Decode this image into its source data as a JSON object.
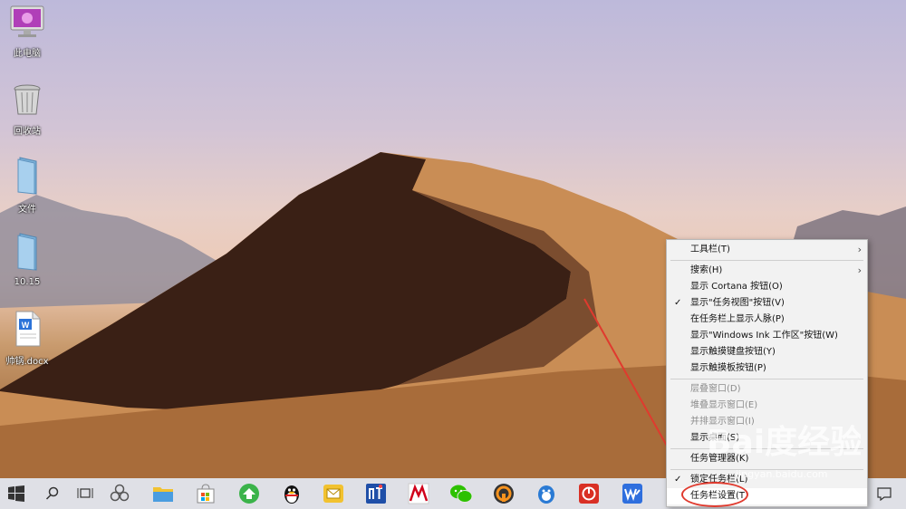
{
  "desktop_icons": [
    {
      "label": "此电脑",
      "icon": "computer-monitor-icon"
    },
    {
      "label": "回收站",
      "icon": "recycle-bin-icon"
    },
    {
      "label": "文件",
      "icon": "folder-icon"
    },
    {
      "label": "10.15",
      "icon": "folder-icon"
    },
    {
      "label": "帅锅.docx",
      "icon": "word-document-icon"
    }
  ],
  "context_menu": {
    "items": [
      {
        "label": "工具栏(T)",
        "has_submenu": true
      },
      {
        "label": "搜索(H)",
        "has_submenu": true
      },
      {
        "label": "显示 Cortana 按钮(O)"
      },
      {
        "label": "显示\"任务视图\"按钮(V)",
        "checked": true
      },
      {
        "label": "在任务栏上显示人脉(P)"
      },
      {
        "label": "显示\"Windows Ink 工作区\"按钮(W)"
      },
      {
        "label": "显示触摸键盘按钮(Y)"
      },
      {
        "label": "显示触摸板按钮(P)"
      },
      {
        "label": "层叠窗口(D)",
        "disabled": true
      },
      {
        "label": "堆叠显示窗口(E)",
        "disabled": true
      },
      {
        "label": "并排显示窗口(I)",
        "disabled": true
      },
      {
        "label": "显示桌面(S)"
      },
      {
        "label": "任务管理器(K)"
      },
      {
        "label": "锁定任务栏(L)",
        "checked": true
      },
      {
        "label": "任务栏设置(T)"
      }
    ]
  },
  "taskbar": {
    "icons": [
      "windows-start-icon",
      "search-icon",
      "task-view-icon",
      "pinwheel-icon",
      "file-explorer-icon",
      "store-icon",
      "browser-icon",
      "qq-penguin-icon",
      "mail-icon",
      "app-icon",
      "app-icon",
      "wechat-icon",
      "vpn-icon",
      "qq-icon",
      "power-app-icon",
      "wps-icon"
    ]
  },
  "watermark": {
    "text": "Bai度经验",
    "url": "jingyan.baidu.com"
  },
  "colors": {
    "annotation_red": "#e03a2e",
    "menu_bg": "#f2f2f2"
  }
}
